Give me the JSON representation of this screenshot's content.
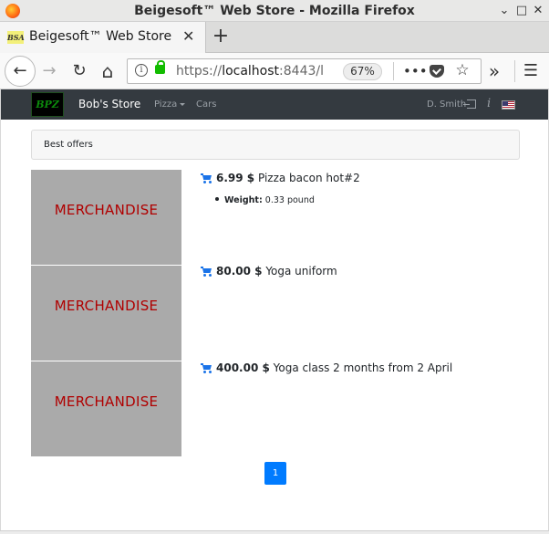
{
  "window": {
    "title": "Beigesoft™ Web Store - Mozilla Firefox",
    "controls": {
      "minimize": "⌄",
      "maximize": "□",
      "close": "✕"
    }
  },
  "tab": {
    "favicon_text": "BSA",
    "title": "Beigesoft™ Web Store",
    "close": "✕",
    "new_tab": "+"
  },
  "navbar": {
    "back": "←",
    "forward": "→",
    "reload": "↻",
    "home": "⌂",
    "url_scheme": "https://",
    "url_host": "localhost",
    "url_rest": ":8443/l",
    "zoom": "67%",
    "page_actions": "•••",
    "star": "☆",
    "overflow": "»",
    "menu": "☰"
  },
  "store": {
    "logo_text": "BPZ",
    "brand": "Bob's Store",
    "menu_pizza": "Pizza",
    "menu_cars": "Cars",
    "user": "D. Smith",
    "info": "i"
  },
  "offers_title": "Best offers",
  "products": [
    {
      "image_text": "MERCHANDISE",
      "price": "6.99 $",
      "name": "Pizza bacon hot#2",
      "attr_label": "Weight:",
      "attr_value": "0.33 pound"
    },
    {
      "image_text": "MERCHANDISE",
      "price": "80.00 $",
      "name": "Yoga uniform"
    },
    {
      "image_text": "MERCHANDISE",
      "price": "400.00 $",
      "name": "Yoga class 2 months from 2 April"
    }
  ],
  "pagination": {
    "current": "1"
  },
  "colors": {
    "store_nav_bg": "#343a40",
    "accent_blue": "#007bff",
    "merch_bg": "#aaaaaa",
    "merch_text": "#b00000"
  }
}
